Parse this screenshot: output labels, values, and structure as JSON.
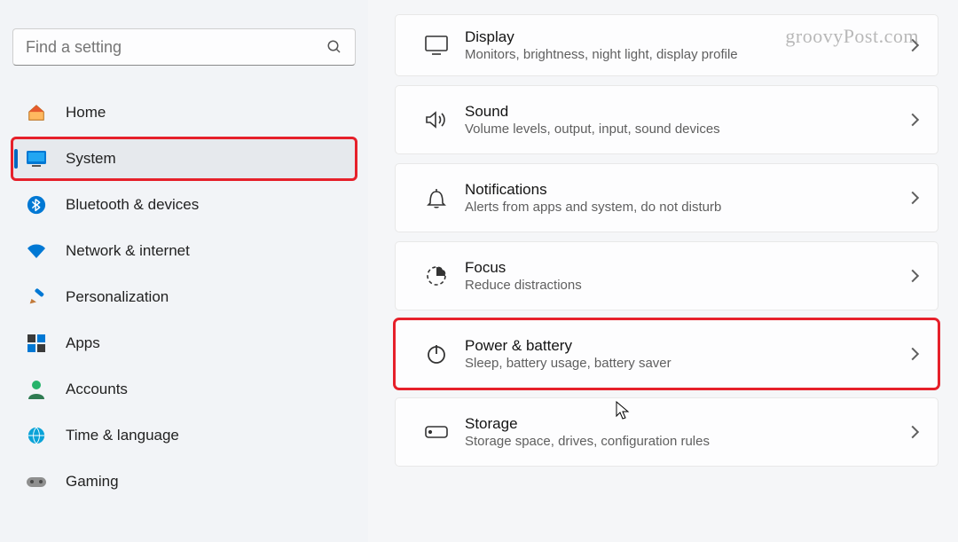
{
  "watermark": "groovyPost.com",
  "search": {
    "placeholder": "Find a setting"
  },
  "sidebar": {
    "items": [
      {
        "label": "Home"
      },
      {
        "label": "System"
      },
      {
        "label": "Bluetooth & devices"
      },
      {
        "label": "Network & internet"
      },
      {
        "label": "Personalization"
      },
      {
        "label": "Apps"
      },
      {
        "label": "Accounts"
      },
      {
        "label": "Time & language"
      },
      {
        "label": "Gaming"
      }
    ]
  },
  "main": {
    "items": [
      {
        "title": "Display",
        "sub": "Monitors, brightness, night light, display profile"
      },
      {
        "title": "Sound",
        "sub": "Volume levels, output, input, sound devices"
      },
      {
        "title": "Notifications",
        "sub": "Alerts from apps and system, do not disturb"
      },
      {
        "title": "Focus",
        "sub": "Reduce distractions"
      },
      {
        "title": "Power & battery",
        "sub": "Sleep, battery usage, battery saver"
      },
      {
        "title": "Storage",
        "sub": "Storage space, drives, configuration rules"
      }
    ]
  }
}
